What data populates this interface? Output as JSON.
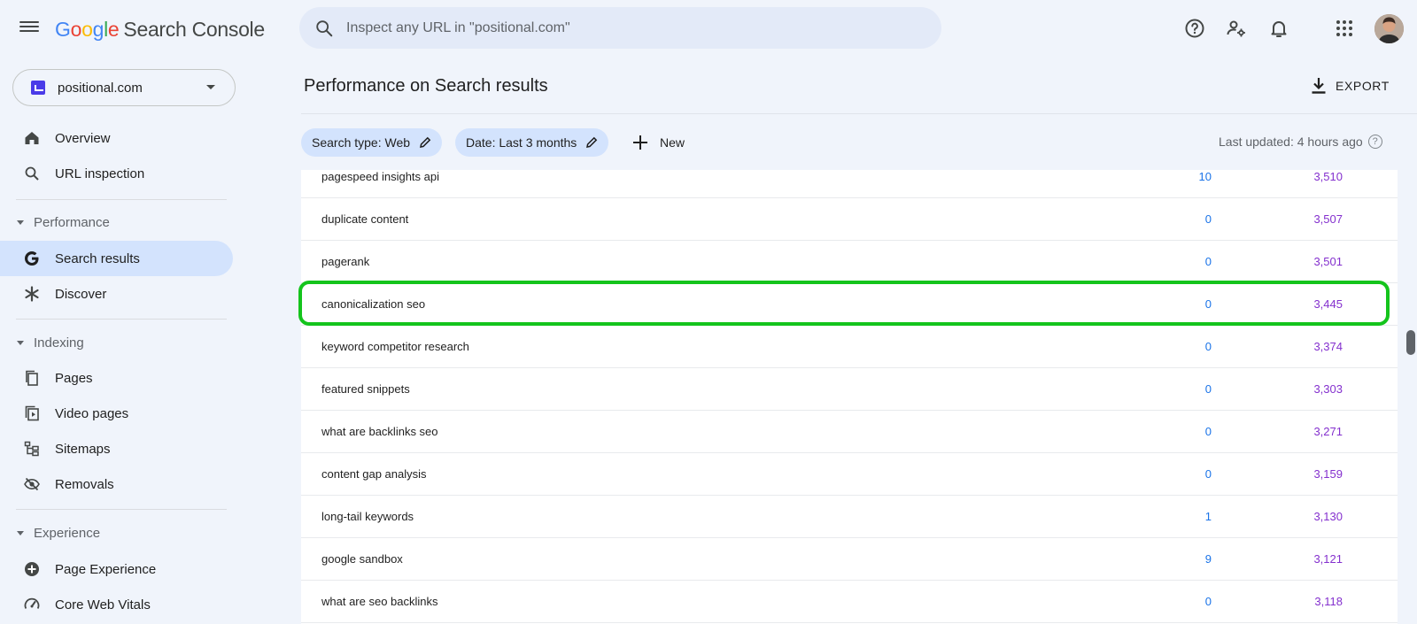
{
  "header": {
    "logo": {
      "letters": [
        "G",
        "o",
        "o",
        "g",
        "l",
        "e"
      ],
      "product": "Search Console"
    },
    "search_placeholder": "Inspect any URL in \"positional.com\""
  },
  "sidebar": {
    "property": "positional.com",
    "items": [
      {
        "label": "Overview",
        "icon": "home-icon"
      },
      {
        "label": "URL inspection",
        "icon": "search-icon"
      }
    ],
    "performance_section": "Performance",
    "performance_items": [
      {
        "label": "Search results",
        "icon": "google-g-icon",
        "active": true
      },
      {
        "label": "Discover",
        "icon": "asterisk-icon",
        "active": false
      }
    ],
    "indexing_section": "Indexing",
    "indexing_items": [
      {
        "label": "Pages",
        "icon": "pages-icon"
      },
      {
        "label": "Video pages",
        "icon": "video-pages-icon"
      },
      {
        "label": "Sitemaps",
        "icon": "sitemap-icon"
      },
      {
        "label": "Removals",
        "icon": "eye-off-icon"
      }
    ],
    "experience_section": "Experience",
    "experience_items": [
      {
        "label": "Page Experience",
        "icon": "plus-circle-icon"
      },
      {
        "label": "Core Web Vitals",
        "icon": "gauge-icon"
      }
    ]
  },
  "main": {
    "title": "Performance on Search results",
    "export_label": "EXPORT",
    "filters": [
      {
        "label": "Search type: Web"
      },
      {
        "label": "Date: Last 3 months"
      }
    ],
    "new_label": "New",
    "last_updated": "Last updated: 4 hours ago",
    "rows": [
      {
        "query": "pagespeed insights api",
        "clicks": "10",
        "impressions": "3,510"
      },
      {
        "query": "duplicate content",
        "clicks": "0",
        "impressions": "3,507"
      },
      {
        "query": "pagerank",
        "clicks": "0",
        "impressions": "3,501"
      },
      {
        "query": "canonicalization seo",
        "clicks": "0",
        "impressions": "3,445",
        "highlighted": true
      },
      {
        "query": "keyword competitor research",
        "clicks": "0",
        "impressions": "3,374"
      },
      {
        "query": "featured snippets",
        "clicks": "0",
        "impressions": "3,303"
      },
      {
        "query": "what are backlinks seo",
        "clicks": "0",
        "impressions": "3,271"
      },
      {
        "query": "content gap analysis",
        "clicks": "0",
        "impressions": "3,159"
      },
      {
        "query": "long-tail keywords",
        "clicks": "1",
        "impressions": "3,130"
      },
      {
        "query": "google sandbox",
        "clicks": "9",
        "impressions": "3,121"
      },
      {
        "query": "what are seo backlinks",
        "clicks": "0",
        "impressions": "3,118"
      }
    ]
  },
  "colors": {
    "accent": "#1a73e8",
    "impressions": "#8430ce",
    "active_nav": "#d3e3fd",
    "highlight_border": "#14c41c"
  }
}
